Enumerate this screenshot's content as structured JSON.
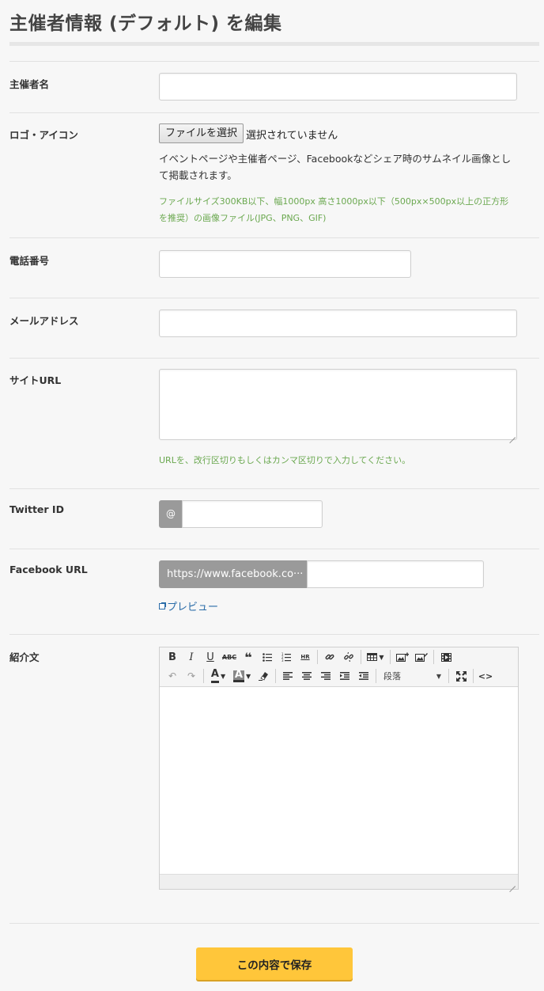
{
  "page": {
    "title": "主催者情報 (デフォルト) を編集"
  },
  "fields": {
    "organizer_name": {
      "label": "主催者名",
      "value": ""
    },
    "logo": {
      "label": "ロゴ・アイコン",
      "button_label": "ファイルを選択",
      "status": "選択されていません",
      "description": "イベントページや主催者ページ、Facebookなどシェア時のサムネイル画像として掲載されます。",
      "hint": "ファイルサイズ300KB以下、幅1000px 高さ1000px以下（500px×500px以上の正方形を推奨）の画像ファイル(JPG、PNG、GIF)"
    },
    "phone": {
      "label": "電話番号",
      "value": ""
    },
    "email": {
      "label": "メールアドレス",
      "value": ""
    },
    "site_url": {
      "label": "サイトURL",
      "value": "",
      "hint": "URLを、改行区切りもしくはカンマ区切りで入力してください。"
    },
    "twitter": {
      "label": "Twitter ID",
      "prefix": "@",
      "value": ""
    },
    "facebook": {
      "label": "Facebook URL",
      "prefix": "https://www.facebook.co···",
      "value": "",
      "preview_label": "プレビュー"
    },
    "intro": {
      "label": "紹介文",
      "format_select": "段落",
      "toolbar_row1": [
        "bold-icon",
        "italic-icon",
        "underline-icon",
        "strikethrough-icon",
        "blockquote-icon",
        "bullet-list-icon",
        "numbered-list-icon",
        "horizontal-rule-icon",
        "link-icon",
        "unlink-icon",
        "table-icon",
        "insert-image-icon",
        "edit-image-icon",
        "media-icon"
      ],
      "toolbar_row2": [
        "undo-icon",
        "redo-icon",
        "text-color-icon",
        "background-color-icon",
        "clear-format-icon",
        "align-left-icon",
        "align-center-icon",
        "align-right-icon",
        "indent-icon",
        "outdent-icon",
        "fullscreen-icon",
        "source-code-icon"
      ]
    }
  },
  "actions": {
    "save_label": "この内容で保存"
  },
  "colors": {
    "accent": "#ffc63a",
    "hint_green": "#6aa84f",
    "link_blue": "#2a6ca8",
    "addon_gray": "#9a9a9a"
  }
}
